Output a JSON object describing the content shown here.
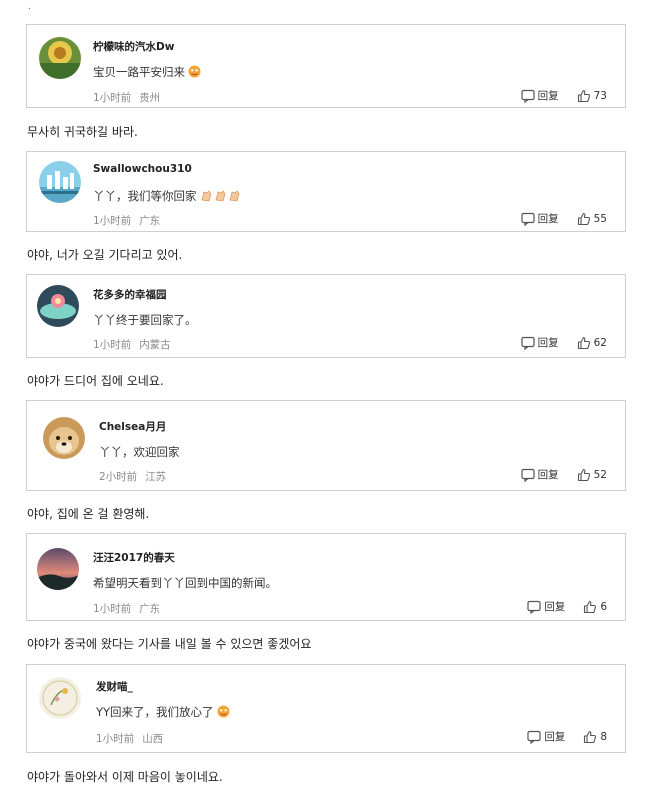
{
  "top_mark": ".",
  "comments": [
    {
      "username": "柠檬味的汽水Dw",
      "text": "宝贝一路平安归来",
      "time": "1小时前",
      "location": "贵州",
      "reply": "回复",
      "likes": "73",
      "emoji": "face-icon",
      "translation": "무사히 귀국하길 바라."
    },
    {
      "username": "Swallowchou310",
      "text": "丫丫，我们等你回家",
      "time": "1小时前",
      "location": "广东",
      "reply": "回复",
      "likes": "55",
      "emoji": "clap-icon",
      "translation": "야야, 너가 오길 기다리고 있어."
    },
    {
      "username": "花多多的幸福园",
      "text": "丫丫终于要回家了。",
      "time": "1小时前",
      "location": "内蒙古",
      "reply": "回复",
      "likes": "62",
      "emoji": "",
      "translation": "야야가 드디어 집에 오네요."
    },
    {
      "username": "Chelsea月月",
      "text": "丫丫，欢迎回家",
      "time": "2小时前",
      "location": "江苏",
      "reply": "回复",
      "likes": "52",
      "emoji": "",
      "translation": "야야, 집에 온 걸 환영해."
    },
    {
      "username": "汪汪2017的春天",
      "text": "希望明天看到丫丫回到中国的新闻。",
      "time": "1小时前",
      "location": "广东",
      "reply": "回复",
      "likes": "6",
      "emoji": "",
      "translation": "야야가 중국에 왔다는 기사를 내일 볼 수 있으면 좋겠어요"
    },
    {
      "username": "发财喵_",
      "text": "YY回来了，我们放心了",
      "time": "1小时前",
      "location": "山西",
      "reply": "回复",
      "likes": "8",
      "emoji": "face-icon",
      "translation": "야야가 돌아와서 이제 마음이 놓이네요."
    }
  ]
}
